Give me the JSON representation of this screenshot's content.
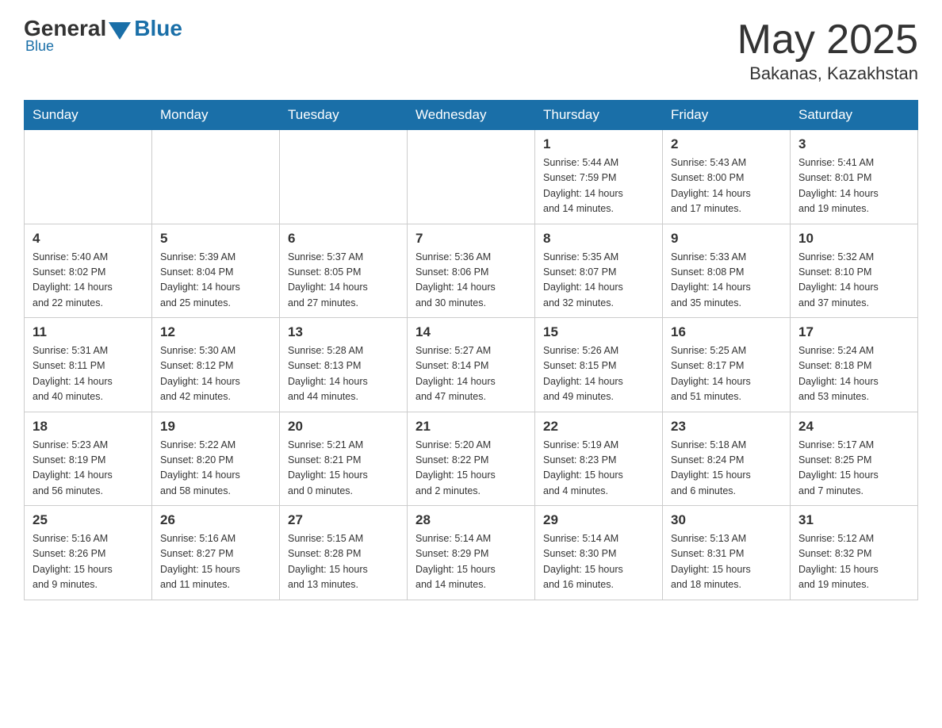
{
  "header": {
    "logo": {
      "general": "General",
      "blue": "Blue"
    },
    "title": "May 2025",
    "location": "Bakanas, Kazakhstan"
  },
  "weekdays": [
    "Sunday",
    "Monday",
    "Tuesday",
    "Wednesday",
    "Thursday",
    "Friday",
    "Saturday"
  ],
  "weeks": [
    [
      {
        "day": "",
        "info": ""
      },
      {
        "day": "",
        "info": ""
      },
      {
        "day": "",
        "info": ""
      },
      {
        "day": "",
        "info": ""
      },
      {
        "day": "1",
        "info": "Sunrise: 5:44 AM\nSunset: 7:59 PM\nDaylight: 14 hours\nand 14 minutes."
      },
      {
        "day": "2",
        "info": "Sunrise: 5:43 AM\nSunset: 8:00 PM\nDaylight: 14 hours\nand 17 minutes."
      },
      {
        "day": "3",
        "info": "Sunrise: 5:41 AM\nSunset: 8:01 PM\nDaylight: 14 hours\nand 19 minutes."
      }
    ],
    [
      {
        "day": "4",
        "info": "Sunrise: 5:40 AM\nSunset: 8:02 PM\nDaylight: 14 hours\nand 22 minutes."
      },
      {
        "day": "5",
        "info": "Sunrise: 5:39 AM\nSunset: 8:04 PM\nDaylight: 14 hours\nand 25 minutes."
      },
      {
        "day": "6",
        "info": "Sunrise: 5:37 AM\nSunset: 8:05 PM\nDaylight: 14 hours\nand 27 minutes."
      },
      {
        "day": "7",
        "info": "Sunrise: 5:36 AM\nSunset: 8:06 PM\nDaylight: 14 hours\nand 30 minutes."
      },
      {
        "day": "8",
        "info": "Sunrise: 5:35 AM\nSunset: 8:07 PM\nDaylight: 14 hours\nand 32 minutes."
      },
      {
        "day": "9",
        "info": "Sunrise: 5:33 AM\nSunset: 8:08 PM\nDaylight: 14 hours\nand 35 minutes."
      },
      {
        "day": "10",
        "info": "Sunrise: 5:32 AM\nSunset: 8:10 PM\nDaylight: 14 hours\nand 37 minutes."
      }
    ],
    [
      {
        "day": "11",
        "info": "Sunrise: 5:31 AM\nSunset: 8:11 PM\nDaylight: 14 hours\nand 40 minutes."
      },
      {
        "day": "12",
        "info": "Sunrise: 5:30 AM\nSunset: 8:12 PM\nDaylight: 14 hours\nand 42 minutes."
      },
      {
        "day": "13",
        "info": "Sunrise: 5:28 AM\nSunset: 8:13 PM\nDaylight: 14 hours\nand 44 minutes."
      },
      {
        "day": "14",
        "info": "Sunrise: 5:27 AM\nSunset: 8:14 PM\nDaylight: 14 hours\nand 47 minutes."
      },
      {
        "day": "15",
        "info": "Sunrise: 5:26 AM\nSunset: 8:15 PM\nDaylight: 14 hours\nand 49 minutes."
      },
      {
        "day": "16",
        "info": "Sunrise: 5:25 AM\nSunset: 8:17 PM\nDaylight: 14 hours\nand 51 minutes."
      },
      {
        "day": "17",
        "info": "Sunrise: 5:24 AM\nSunset: 8:18 PM\nDaylight: 14 hours\nand 53 minutes."
      }
    ],
    [
      {
        "day": "18",
        "info": "Sunrise: 5:23 AM\nSunset: 8:19 PM\nDaylight: 14 hours\nand 56 minutes."
      },
      {
        "day": "19",
        "info": "Sunrise: 5:22 AM\nSunset: 8:20 PM\nDaylight: 14 hours\nand 58 minutes."
      },
      {
        "day": "20",
        "info": "Sunrise: 5:21 AM\nSunset: 8:21 PM\nDaylight: 15 hours\nand 0 minutes."
      },
      {
        "day": "21",
        "info": "Sunrise: 5:20 AM\nSunset: 8:22 PM\nDaylight: 15 hours\nand 2 minutes."
      },
      {
        "day": "22",
        "info": "Sunrise: 5:19 AM\nSunset: 8:23 PM\nDaylight: 15 hours\nand 4 minutes."
      },
      {
        "day": "23",
        "info": "Sunrise: 5:18 AM\nSunset: 8:24 PM\nDaylight: 15 hours\nand 6 minutes."
      },
      {
        "day": "24",
        "info": "Sunrise: 5:17 AM\nSunset: 8:25 PM\nDaylight: 15 hours\nand 7 minutes."
      }
    ],
    [
      {
        "day": "25",
        "info": "Sunrise: 5:16 AM\nSunset: 8:26 PM\nDaylight: 15 hours\nand 9 minutes."
      },
      {
        "day": "26",
        "info": "Sunrise: 5:16 AM\nSunset: 8:27 PM\nDaylight: 15 hours\nand 11 minutes."
      },
      {
        "day": "27",
        "info": "Sunrise: 5:15 AM\nSunset: 8:28 PM\nDaylight: 15 hours\nand 13 minutes."
      },
      {
        "day": "28",
        "info": "Sunrise: 5:14 AM\nSunset: 8:29 PM\nDaylight: 15 hours\nand 14 minutes."
      },
      {
        "day": "29",
        "info": "Sunrise: 5:14 AM\nSunset: 8:30 PM\nDaylight: 15 hours\nand 16 minutes."
      },
      {
        "day": "30",
        "info": "Sunrise: 5:13 AM\nSunset: 8:31 PM\nDaylight: 15 hours\nand 18 minutes."
      },
      {
        "day": "31",
        "info": "Sunrise: 5:12 AM\nSunset: 8:32 PM\nDaylight: 15 hours\nand 19 minutes."
      }
    ]
  ]
}
